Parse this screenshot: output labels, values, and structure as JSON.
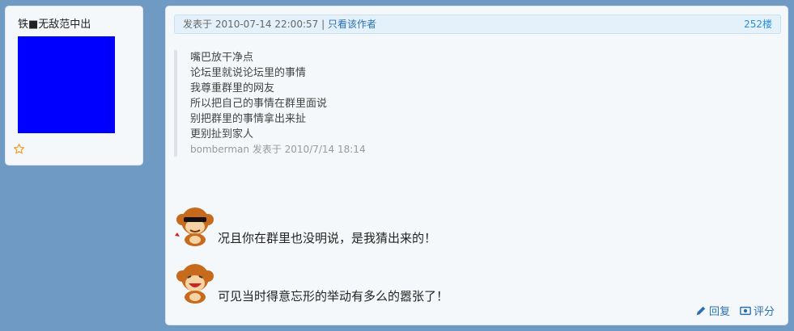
{
  "user": {
    "name": "铁■无敌范中出",
    "avatar_color": "#0000ff",
    "star_icon": "star-outline-icon"
  },
  "post": {
    "posted_at": "发表于 2010-07-14 22:00:57",
    "separator": "|",
    "author_only_link": "只看该作者",
    "floor": "252楼",
    "quote": {
      "lines": [
        "嘴巴放干净点",
        "论坛里就说论坛里的事情",
        "我尊重群里的网友",
        "所以把自己的事情在群里面说",
        "别把群里的事情拿出来扯",
        "更别扯到家人"
      ],
      "meta": "bomberman 发表于 2010/7/14 18:14"
    },
    "body_lines": [
      {
        "emoticon": "monkey-sunglasses-icon",
        "text": "况且你在群里也没明说，是我猜出来的！"
      },
      {
        "emoticon": "monkey-laughing-icon",
        "text": "可见当时得意忘形的举动有多么的嚣张了！"
      }
    ],
    "actions": {
      "reply": "回复",
      "rate": "评分"
    }
  }
}
